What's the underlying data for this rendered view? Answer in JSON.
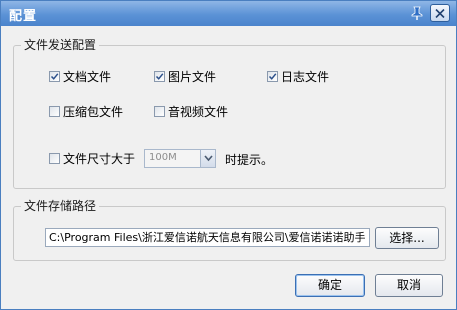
{
  "window": {
    "title": "配置",
    "pin_icon": "pin-icon",
    "close_icon": "close-icon"
  },
  "send_group": {
    "legend": "文件发送配置",
    "options": [
      {
        "label": "文档文件",
        "checked": true
      },
      {
        "label": "图片文件",
        "checked": true
      },
      {
        "label": "日志文件",
        "checked": true
      },
      {
        "label": "压缩包文件",
        "checked": false
      },
      {
        "label": "音视频文件",
        "checked": false
      }
    ],
    "size_limit": {
      "label": "文件尺寸大于",
      "checked": false,
      "value": "100M",
      "suffix": "时提示。"
    }
  },
  "storage_group": {
    "legend": "文件存储路径",
    "path": "C:\\Program Files\\浙江爱信诺航天信息有限公司\\爱信诺诺诺助手",
    "browse_label": "选择..."
  },
  "footer": {
    "ok_label": "确定",
    "cancel_label": "取消"
  },
  "colors": {
    "titlebar": "#5b92d6",
    "window_bg": "#f0f0f0"
  }
}
